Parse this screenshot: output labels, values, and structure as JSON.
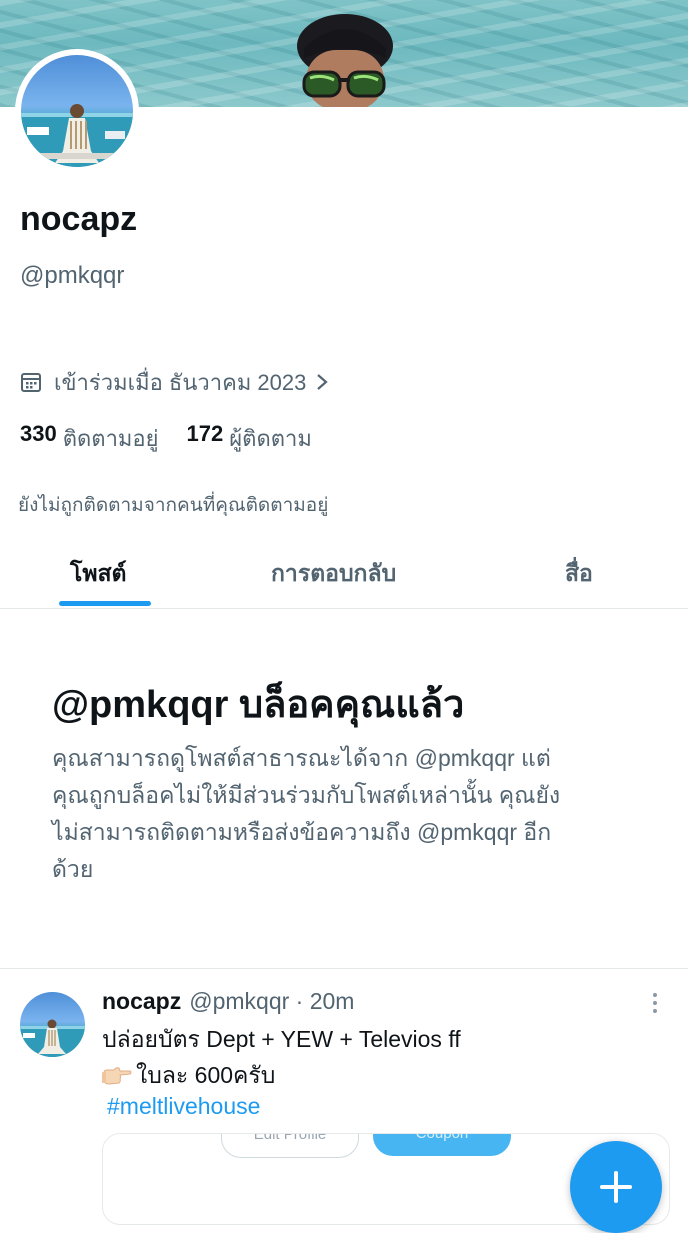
{
  "profile": {
    "display_name": "nocapz",
    "handle": "@pmkqqr",
    "joined": "เข้าร่วมเมื่อ ธันวาคม 2023",
    "following_count": "330",
    "following_label": "ติดตามอยู่",
    "followers_count": "172",
    "followers_label": "ผู้ติดตาม",
    "not_followed_note": "ยังไม่ถูกติดตามจากคนที่คุณติดตามอยู่"
  },
  "tabs": [
    {
      "label": "โพสต์",
      "active": true
    },
    {
      "label": "การตอบกลับ",
      "active": false
    },
    {
      "label": "สื่อ",
      "active": false
    }
  ],
  "blocked": {
    "title": "@pmkqqr บล็อคคุณแล้ว",
    "lines": [
      "คุณสามารถดูโพสต์สาธารณะได้จาก @pmkqqr แต่",
      "คุณถูกบล็อคไม่ให้มีส่วนร่วมกับโพสต์เหล่านั้น คุณยัง",
      "ไม่สามารถติดตามหรือส่งข้อความถึง @pmkqqr อีก",
      "ด้วย"
    ]
  },
  "tweet": {
    "author": "nocapz",
    "meta": "@pmkqqr · 20m",
    "line1": "ปล่อยบัตร Dept + YEW + Televios ff",
    "line2": "ใบละ 600ครับ",
    "hashtag": "#meltlivehouse",
    "embed_button_1": "Edit Profile",
    "embed_button_2": "Coupon"
  },
  "colors": {
    "accent": "#1d9bf0",
    "secondary_text": "#536471",
    "primary_text": "#0f1419"
  },
  "icons": [
    "calendar-icon",
    "chevron-right-icon",
    "more-vertical-icon",
    "plus-icon",
    "pointing-hand-icon"
  ]
}
